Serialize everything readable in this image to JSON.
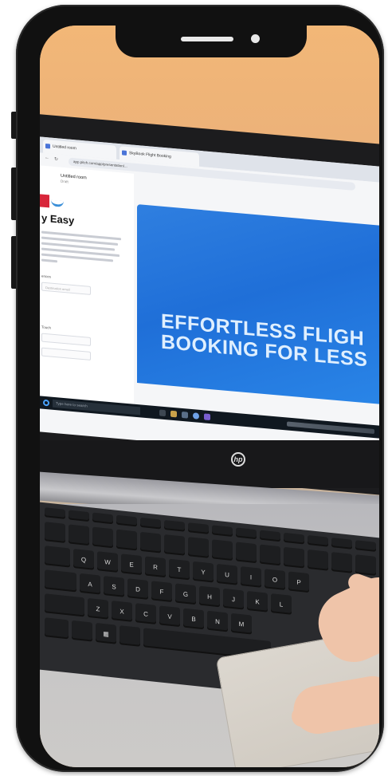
{
  "photo": {
    "subject": "",
    "browser_tabs": [
      "Untitled room",
      "SkyBook Flight Booking"
    ],
    "browser_url": "app.pitch.com/app/presentation/...",
    "document": {
      "title": "Untitled room",
      "subtitle": "Draft"
    },
    "page_headline": "y Easy",
    "page_body_lines": [
      "flights easily, find the best deals, and",
      "travel stress-free! whether you're a",
      "ent flyer or just planning your next",
      "you'll get instant tips, exclusive deals,",
      "expert guidance to make booking a",
      "e."
    ],
    "page_field_labels": [
      "ences",
      "Touch"
    ],
    "page_field_placeholders": [
      "Destination email",
      "",
      ""
    ],
    "hero_lines": [
      "EFFORTLESS FLIGH",
      "BOOKING FOR LESS"
    ],
    "taskbar_search": "Type here to search",
    "laptop_logo": "hp",
    "keys": {
      "row_letters_1": [
        "Q",
        "W",
        "E",
        "R",
        "T",
        "Y",
        "U",
        "I",
        "O",
        "P"
      ],
      "row_letters_2": [
        "A",
        "S",
        "D",
        "F",
        "G",
        "H",
        "J",
        "K",
        "L"
      ],
      "row_letters_3": [
        "Z",
        "X",
        "C",
        "V",
        "B",
        "N",
        "M"
      ]
    }
  },
  "colors": {
    "wall": "#efb57a",
    "hero_blue": "#2a7de0",
    "hero_text": "#dfefff",
    "brand_red": "#d8263a"
  }
}
